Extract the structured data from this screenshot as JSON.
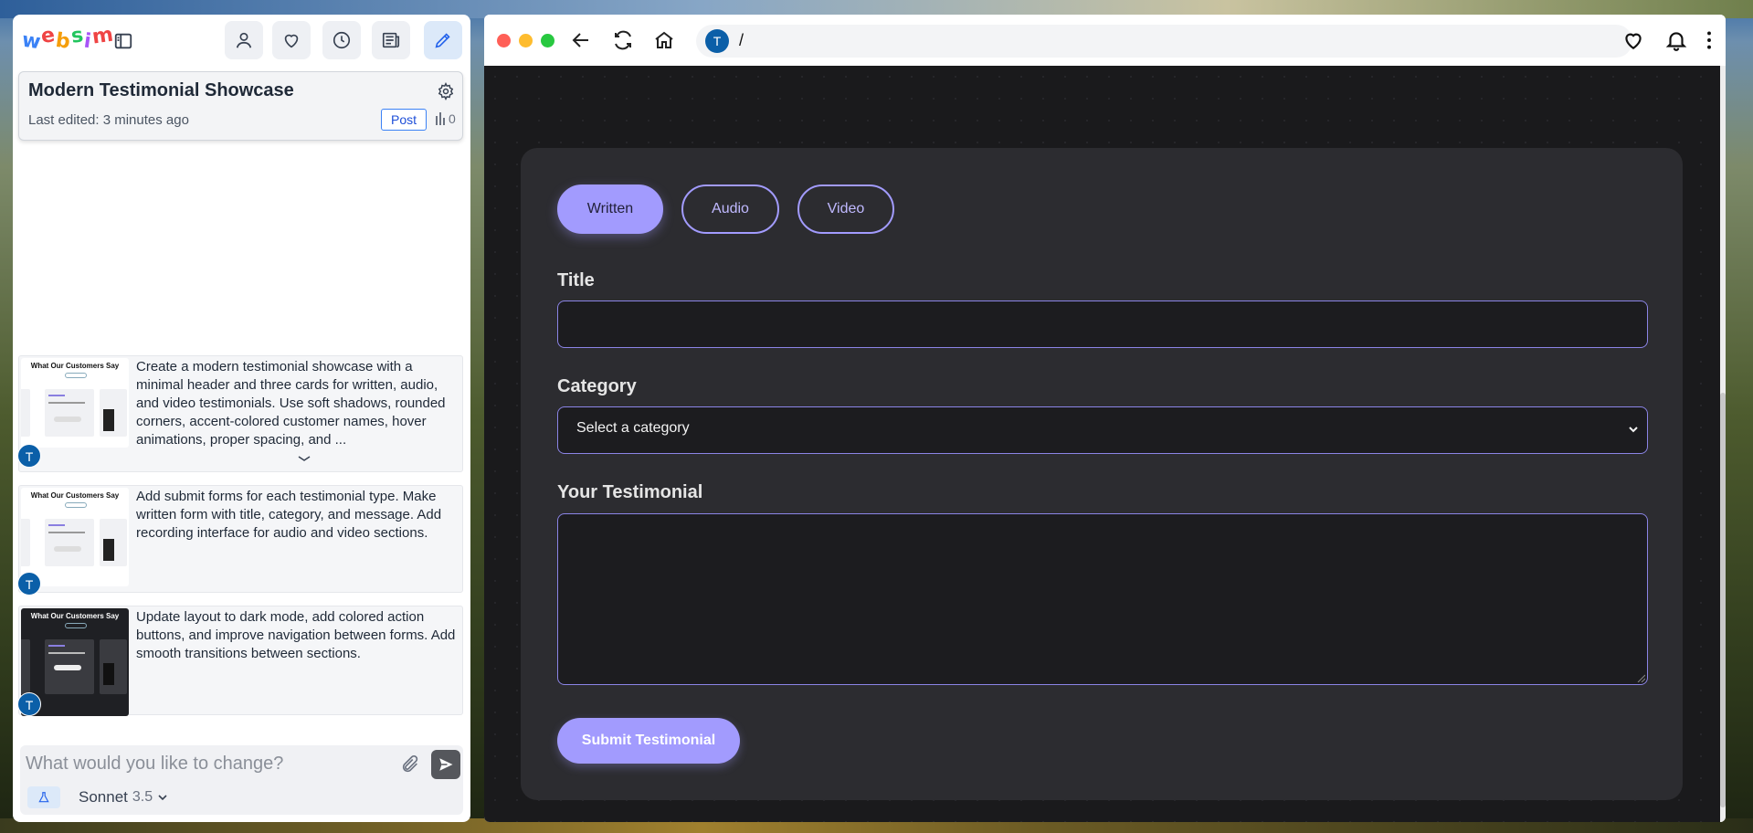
{
  "editor": {
    "logo_letters": [
      "w",
      "e",
      "b",
      "s",
      "i",
      "m"
    ],
    "logo_colors": [
      "#3b82f6",
      "#ef4444",
      "#f59e0b",
      "#22c55e",
      "#a855f7",
      "#ef4444"
    ],
    "toolbar_icons": [
      "user-icon",
      "heart-icon",
      "clock-icon",
      "newspaper-icon",
      "pencil-icon"
    ],
    "project": {
      "title": "Modern Testimonial Showcase",
      "last_edited": "Last edited: 3 minutes ago",
      "post_label": "Post",
      "views": "0"
    },
    "history": [
      {
        "thumb_title": "What Our Customers Say",
        "text": "Create a modern testimonial showcase with a minimal header and three cards for written, audio, and video testimonials. Use soft shadows, rounded corners, accent-colored customer names, hover animations, proper spacing, and ...",
        "avatar": "T"
      },
      {
        "thumb_title": "What Our Customers Say",
        "text": "Add submit forms for each testimonial type. Make written form with title, category, and message. Add recording interface for audio and video sections.",
        "avatar": "T"
      },
      {
        "thumb_title": "What Our Customers Say",
        "text": "Update layout to dark mode, add colored action buttons, and improve navigation between forms. Add smooth transitions between sections.",
        "avatar": "T"
      }
    ],
    "chat": {
      "placeholder": "What would you like to change?",
      "model_name": "Sonnet",
      "model_version": "3.5"
    }
  },
  "browser": {
    "url_avatar": "T",
    "url": "/",
    "traffic_colors": [
      "#ff5f57",
      "#febc2e",
      "#28c840"
    ]
  },
  "form": {
    "tabs": [
      {
        "label": "Written",
        "active": true
      },
      {
        "label": "Audio",
        "active": false
      },
      {
        "label": "Video",
        "active": false
      }
    ],
    "title_label": "Title",
    "title_value": "",
    "category_label": "Category",
    "category_selected": "Select a category",
    "testimonial_label": "Your Testimonial",
    "testimonial_value": "",
    "submit_label": "Submit Testimonial",
    "accent_color": "#a29bfe"
  }
}
